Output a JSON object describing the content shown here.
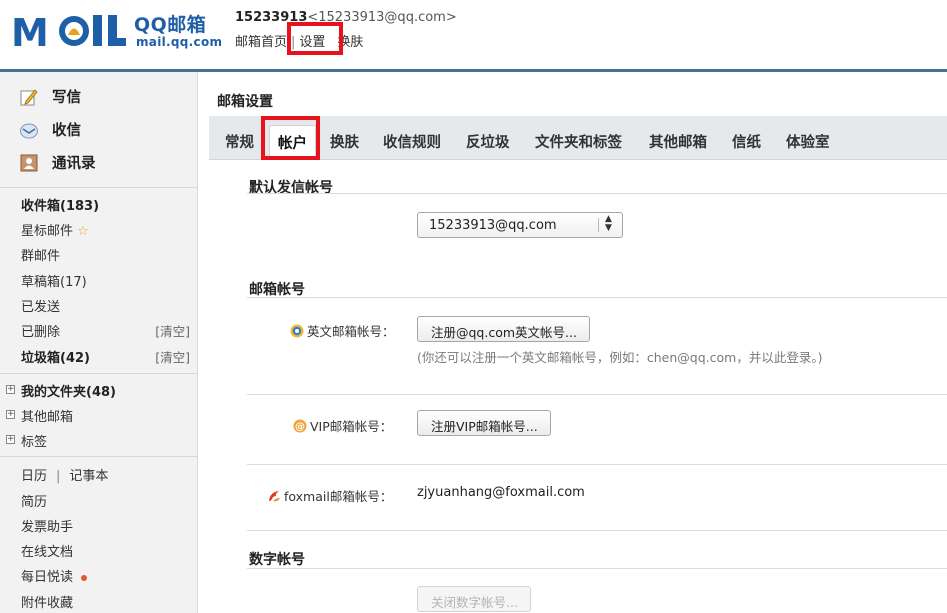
{
  "brand": {
    "logo_text": "MOIL",
    "name_cn": "QQ邮箱",
    "domain": "mail.qq.com",
    "brand_color": "#1f5fa8"
  },
  "user": {
    "qq_number": "15233913",
    "email_display": "<15233913@qq.com>"
  },
  "top_nav": {
    "home": "邮箱首页",
    "sep": "|",
    "settings": "设置",
    "skin": "换肤"
  },
  "sidebar": {
    "quick": [
      {
        "label": "写信",
        "icon": "pencil-icon"
      },
      {
        "label": "收信",
        "icon": "inbox-icon"
      },
      {
        "label": "通讯录",
        "icon": "contacts-icon"
      }
    ],
    "folders": [
      {
        "label": "收件箱(183)"
      },
      {
        "label": "星标邮件"
      },
      {
        "label": "群邮件"
      },
      {
        "label": "草稿箱(17)"
      },
      {
        "label": "已发送"
      },
      {
        "label": "已删除",
        "action": "[清空]"
      },
      {
        "label": "垃圾箱(42)",
        "action": "[清空]"
      }
    ],
    "groups": [
      {
        "label": "我的文件夹(48)"
      },
      {
        "label": "其他邮箱"
      },
      {
        "label": "标签"
      }
    ],
    "tools": {
      "calendar": "日历",
      "tools_sep": "|",
      "notes": "记事本",
      "resume": "简历",
      "invoice": "发票助手",
      "docs": "在线文档",
      "daily_read": "每日悦读",
      "attachments": "附件收藏"
    }
  },
  "main": {
    "title": "邮箱设置",
    "tabs": [
      "常规",
      "帐户",
      "换肤",
      "收信规则",
      "反垃圾",
      "文件夹和标签",
      "其他邮箱",
      "信纸",
      "体验室"
    ],
    "active_tab": "帐户",
    "default_sender": {
      "title": "默认发信帐号",
      "value": "15233913@qq.com"
    },
    "accounts": {
      "title": "邮箱帐号",
      "english_label": "英文邮箱帐号：",
      "english_button": "注册@qq.com英文帐号...",
      "english_hint": "(你还可以注册一个英文邮箱帐号，例如：chen@qq.com，并以此登录。)",
      "vip_label": "VIP邮箱帐号：",
      "vip_button": "注册VIP邮箱帐号...",
      "foxmail_label": "foxmail邮箱帐号：",
      "foxmail_value": "zjyuanhang@foxmail.com"
    },
    "digital": {
      "title": "数字帐号",
      "button": "关闭数字帐号..."
    }
  },
  "colors": {
    "highlight": "#e8121c",
    "header_rule": "#4a6f96",
    "unread_dot": "#e3582a",
    "star": "#e6a817"
  }
}
